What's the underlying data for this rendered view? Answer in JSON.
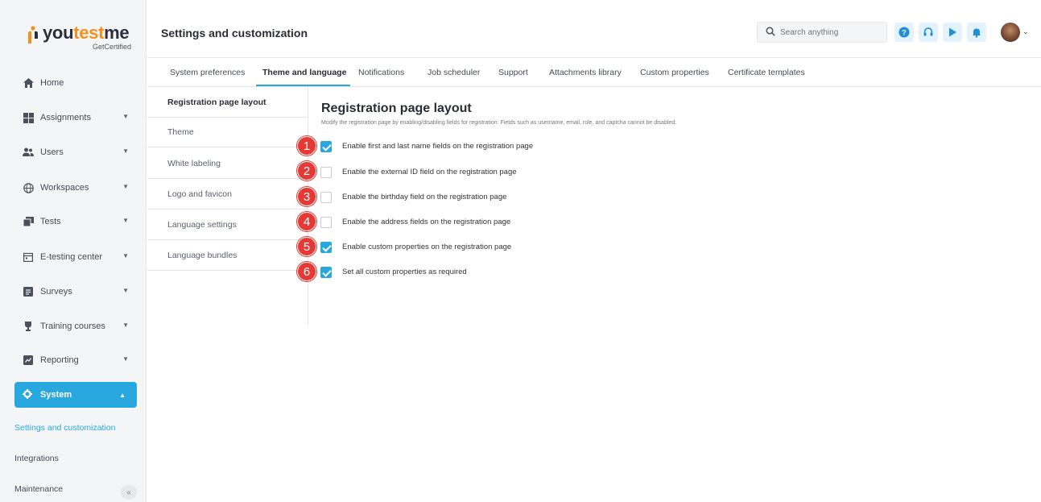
{
  "brand": {
    "name_part1": "you",
    "name_accent": "test",
    "name_part2": "me",
    "tagline": "GetCertified"
  },
  "sidebar": {
    "items": [
      {
        "label": "Home",
        "icon": "home-icon"
      },
      {
        "label": "Assignments",
        "icon": "assignments-icon"
      },
      {
        "label": "Users",
        "icon": "users-icon"
      },
      {
        "label": "Workspaces",
        "icon": "globe-icon"
      },
      {
        "label": "Tests",
        "icon": "tests-icon"
      },
      {
        "label": "E-testing center",
        "icon": "calendar-icon"
      },
      {
        "label": "Surveys",
        "icon": "surveys-icon"
      },
      {
        "label": "Training courses",
        "icon": "trophy-icon"
      },
      {
        "label": "Reporting",
        "icon": "reporting-icon"
      }
    ],
    "active": {
      "label": "System",
      "icon": "gear-icon"
    },
    "subitems": [
      {
        "label": "Settings and customization"
      },
      {
        "label": "Integrations"
      },
      {
        "label": "Maintenance"
      }
    ],
    "collapse_glyph": "«"
  },
  "header": {
    "title": "Settings and customization",
    "search_placeholder": "Search anything",
    "colors": {
      "accent": "#29a8e0",
      "badge": "#e53935",
      "system_bg": "#29a8e0"
    }
  },
  "tabs": [
    {
      "label": "System preferences"
    },
    {
      "label": "Theme and language"
    },
    {
      "label": "Notifications"
    },
    {
      "label": "Job scheduler"
    },
    {
      "label": "Support"
    },
    {
      "label": "Attachments library"
    },
    {
      "label": "Custom properties"
    },
    {
      "label": "Certificate templates"
    }
  ],
  "subnav": [
    {
      "label": "Registration page layout"
    },
    {
      "label": "Theme"
    },
    {
      "label": "White labeling"
    },
    {
      "label": "Logo and favicon"
    },
    {
      "label": "Language settings"
    },
    {
      "label": "Language bundles"
    }
  ],
  "content": {
    "title": "Registration page layout",
    "description": "Modify the registration page by enabling/disabling fields for registration. Fields such as username, email, role, and captcha cannot be disabled.",
    "options": [
      {
        "badge": "1",
        "label": "Enable first and last name fields on the registration page",
        "checked": true
      },
      {
        "badge": "2",
        "label": "Enable the external ID field on the registration page",
        "checked": false
      },
      {
        "badge": "3",
        "label": "Enable the birthday field on the registration page",
        "checked": false
      },
      {
        "badge": "4",
        "label": "Enable the address fields on the registration page",
        "checked": false
      },
      {
        "badge": "5",
        "label": "Enable custom properties on the registration page",
        "checked": true
      },
      {
        "badge": "6",
        "label": "Set all custom properties as required",
        "checked": true
      }
    ]
  }
}
